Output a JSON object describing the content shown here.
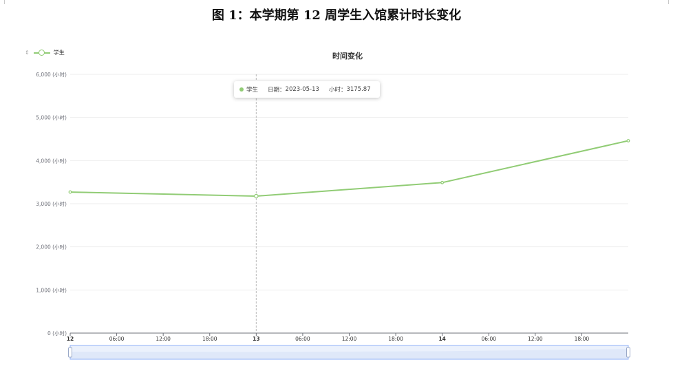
{
  "figure_title": "图 1：本学期第 12 周学生入馆累计时长变化",
  "legend": {
    "arrow": "⇕",
    "label": "学生"
  },
  "tooltip": {
    "series": "学生",
    "date_label": "日期：",
    "date_value": "2023-05-13",
    "value_label": "小时：",
    "value": "3175.87"
  },
  "colors": {
    "series": "#91cc75",
    "grid": "#eeeeee",
    "axis": "#6e7079",
    "zoom_fill": "#e3ebfb",
    "zoom_border": "#d2dbee"
  },
  "chart_data": {
    "type": "line",
    "title": "时间变化",
    "xlabel": "",
    "ylabel": "",
    "ylim": [
      0,
      6000
    ],
    "y_ticks": [
      "0 (小时)",
      "1,000 (小时)",
      "2,000 (小时)",
      "3,000 (小时)",
      "4,000 (小时)",
      "5,000 (小时)",
      "6,000 (小时)"
    ],
    "x_range": [
      "2023-05-12 00:00",
      "2023-05-15 00:00"
    ],
    "x_ticks": [
      {
        "t": "2023-05-12 00:00",
        "label": "12",
        "major": true
      },
      {
        "t": "2023-05-12 06:00",
        "label": "06:00",
        "major": false
      },
      {
        "t": "2023-05-12 12:00",
        "label": "12:00",
        "major": false
      },
      {
        "t": "2023-05-12 18:00",
        "label": "18:00",
        "major": false
      },
      {
        "t": "2023-05-13 00:00",
        "label": "13",
        "major": true
      },
      {
        "t": "2023-05-13 06:00",
        "label": "06:00",
        "major": false
      },
      {
        "t": "2023-05-13 12:00",
        "label": "12:00",
        "major": false
      },
      {
        "t": "2023-05-13 18:00",
        "label": "18:00",
        "major": false
      },
      {
        "t": "2023-05-14 00:00",
        "label": "14",
        "major": true
      },
      {
        "t": "2023-05-14 06:00",
        "label": "06:00",
        "major": false
      },
      {
        "t": "2023-05-14 12:00",
        "label": "12:00",
        "major": false
      },
      {
        "t": "2023-05-14 18:00",
        "label": "18:00",
        "major": false
      }
    ],
    "series": [
      {
        "name": "学生",
        "points": [
          {
            "x": "2023-05-12 00:00",
            "y": 3270
          },
          {
            "x": "2023-05-13 00:00",
            "y": 3175.87
          },
          {
            "x": "2023-05-14 00:00",
            "y": 3490
          },
          {
            "x": "2023-05-15 00:00",
            "y": 4460
          }
        ]
      }
    ],
    "highlighted_x": "2023-05-13 00:00",
    "grid": true,
    "legend_position": "top-left",
    "data_zoom": {
      "start_percent": 0,
      "end_percent": 100
    }
  }
}
